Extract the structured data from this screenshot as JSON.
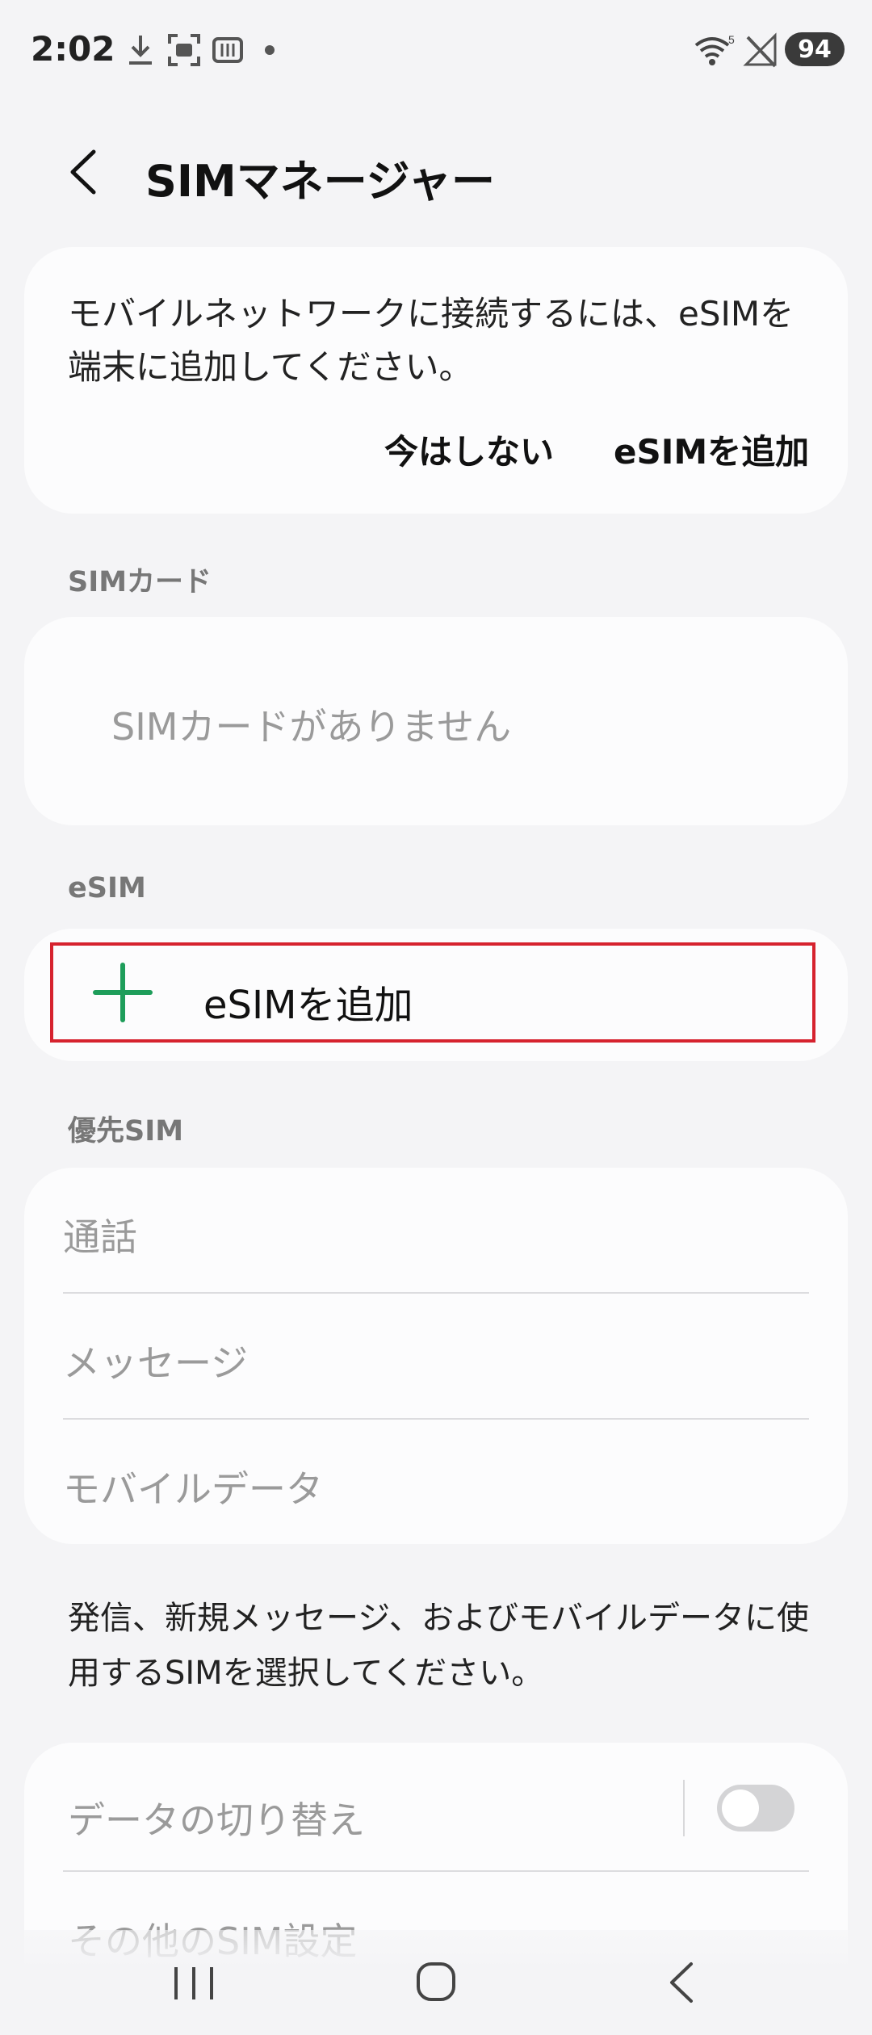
{
  "status_bar": {
    "time": "2:02",
    "battery": "94",
    "icons": [
      "download-icon",
      "screenshot-icon",
      "media-icon",
      "dot-icon",
      "wifi-icon",
      "no-signal-icon",
      "battery-icon"
    ]
  },
  "header": {
    "title": "SIMマネージャー",
    "back_icon": "chevron-left-icon"
  },
  "notice": {
    "text": "モバイルネットワークに接続するには、eSIMを端末に追加してください。",
    "not_now_label": "今はしない",
    "add_esim_label": "eSIMを追加"
  },
  "sim_card_section": {
    "label": "SIMカード",
    "empty_text": "SIMカードがありません"
  },
  "esim_section": {
    "label": "eSIM",
    "add_label": "eSIMを追加",
    "add_icon": "plus-icon",
    "accent_color": "#1e9d5a",
    "highlight_color": "#d6222e"
  },
  "preferred_sim_section": {
    "label": "優先SIM",
    "items": [
      {
        "label": "通話"
      },
      {
        "label": "メッセージ"
      },
      {
        "label": "モバイルデータ"
      }
    ],
    "footnote": "発信、新規メッセージ、およびモバイルデータに使用するSIMを選択してください。"
  },
  "data_switch": {
    "label": "データの切り替え",
    "enabled": false
  },
  "other_settings": {
    "label": "その他のSIM設定"
  },
  "nav_bar": {
    "icons": [
      "recent-apps-icon",
      "home-icon",
      "back-icon"
    ]
  }
}
